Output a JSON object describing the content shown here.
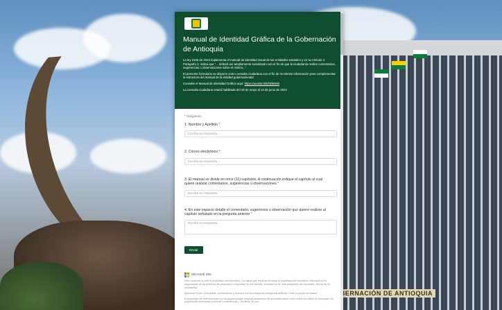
{
  "form": {
    "title": "Manual de Identidad Gráfica de la Gobernación de Antioquia",
    "intro": "La ley 2345 de 2023 implementa el manual de identidad visual de las entidades estatales y en su Artículo 4. Parágrafo 2, indica que \"... deberá ser ampliamente socializado con el fin de que la ciudadanía realice comentarios, sugerencias u observaciones sobre el mismo...\"",
    "purpose": "El presente formulario se dispone como consulta ciudadana con el fin de recolectar información para complementar la estructura del manual de la entidad gubernamental.",
    "consult_text": "Consulte el Manual de Identidad Gráfica aquí:",
    "consult_link": "https://acortar.link/hDkN60",
    "dates": "La consulta ciudadana estará habilitada del 29 de mayo al 14 de junio de 2024",
    "required_note": "* Obligatorio",
    "questions": [
      {
        "num": "1.",
        "label": "Nombre y Apellido",
        "req": "*",
        "placeholder": "Escriba su respuesta"
      },
      {
        "num": "2.",
        "label": "Correo electrónico",
        "req": "*",
        "placeholder": "Escriba su respuesta"
      },
      {
        "num": "3.",
        "label": "El manual se divide en  once (11) capítulos. A continuación indique el capítulo al cual quiere realizar comentarios, sugerencias u observaciones",
        "req": "*",
        "placeholder": "Escriba su respuesta"
      },
      {
        "num": "4.",
        "label": "En este espacio detalle el comentario, sugerencia u observación que quiere realizar al capítulo señalado en la pregunta anterior",
        "req": "*",
        "placeholder": "Escriba su respuesta"
      }
    ],
    "submit_label": "Enviar",
    "footer_brand": "Microsoft 365",
    "footer_text1": "Este contenido lo creó el propietario del formulario. Los datos que envíe se enviarán al propietario del formulario. Microsoft no es responsable de las prácticas de privacidad o seguridad de sus clientes, incluidas las de este propietario del formulario. Nunca dé su contraseña.",
    "footer_text2": "Microsoft Forms | Encuestas, cuestionarios y sondeos con tecnología de inteligencia artificial. Crear mi propio formulario",
    "footer_text3": "El propietario de este formulario no ha proporcionado ninguna declaración de privacidad sobre cómo usará sus datos de respuesta. No proporcione información personal o confidencial. | Términos de uso"
  },
  "background": {
    "sign_text": "GOBERNACIÓN DE ANTIOQUIA"
  },
  "colors": {
    "header_green": "#0e4d2f",
    "required_red": "#c4314b"
  }
}
